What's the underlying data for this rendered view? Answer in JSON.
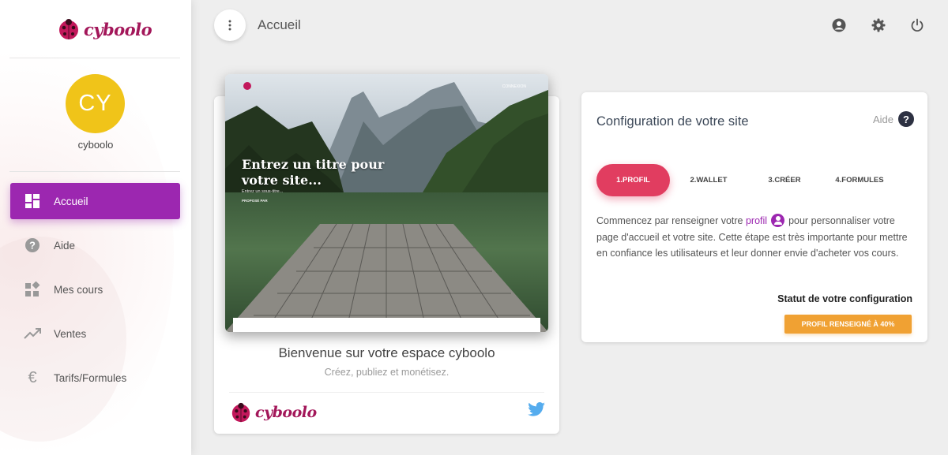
{
  "brand": {
    "name": "cyboolo",
    "accent": "#9c27b0"
  },
  "user": {
    "initials": "CY",
    "name": "cyboolo",
    "avatar_color": "#f0c419"
  },
  "sidebar": {
    "items": [
      {
        "label": "Accueil",
        "icon": "dashboard-icon",
        "active": true
      },
      {
        "label": "Aide",
        "icon": "help-circle-icon",
        "active": false
      },
      {
        "label": "Mes cours",
        "icon": "widgets-icon",
        "active": false
      },
      {
        "label": "Ventes",
        "icon": "trending-up-icon",
        "active": false
      },
      {
        "label": "Tarifs/Formules",
        "icon": "euro-icon",
        "active": false
      }
    ]
  },
  "header": {
    "title": "Accueil",
    "icons": [
      "account-circle-icon",
      "settings-icon",
      "power-icon"
    ]
  },
  "welcome": {
    "hero_title": "Entrez un titre pour votre site...",
    "hero_subtitle": "Entrez un sous-titre...",
    "hero_by": "PROPOSÉ PAR",
    "hero_login": "CONNEXION",
    "title": "Bienvenue sur votre espace cyboolo",
    "subtitle": "Créez, publiez et monétisez.",
    "footer_brand": "cyboolo"
  },
  "config": {
    "title": "Configuration de votre site",
    "help_label": "Aide",
    "steps": [
      {
        "label": "1.PROFIL",
        "active": true
      },
      {
        "label": "2.WALLET",
        "active": false
      },
      {
        "label": "3.CRÉER",
        "active": false
      },
      {
        "label": "4.FORMULES",
        "active": false
      }
    ],
    "text_before": "Commencez par renseigner votre",
    "text_link": "profil",
    "text_after": "pour personnaliser votre page d'accueil et votre site. Cette étape est très importante pour mettre en confiance les utilisateurs et leur donner envie d'acheter vos cours.",
    "status_label": "Statut de votre configuration",
    "status_value": "PROFIL RENSEIGNÉ À 40%",
    "progress_percent": 40,
    "colors": {
      "step_active": "#e13d60",
      "status": "#f0a133"
    }
  }
}
